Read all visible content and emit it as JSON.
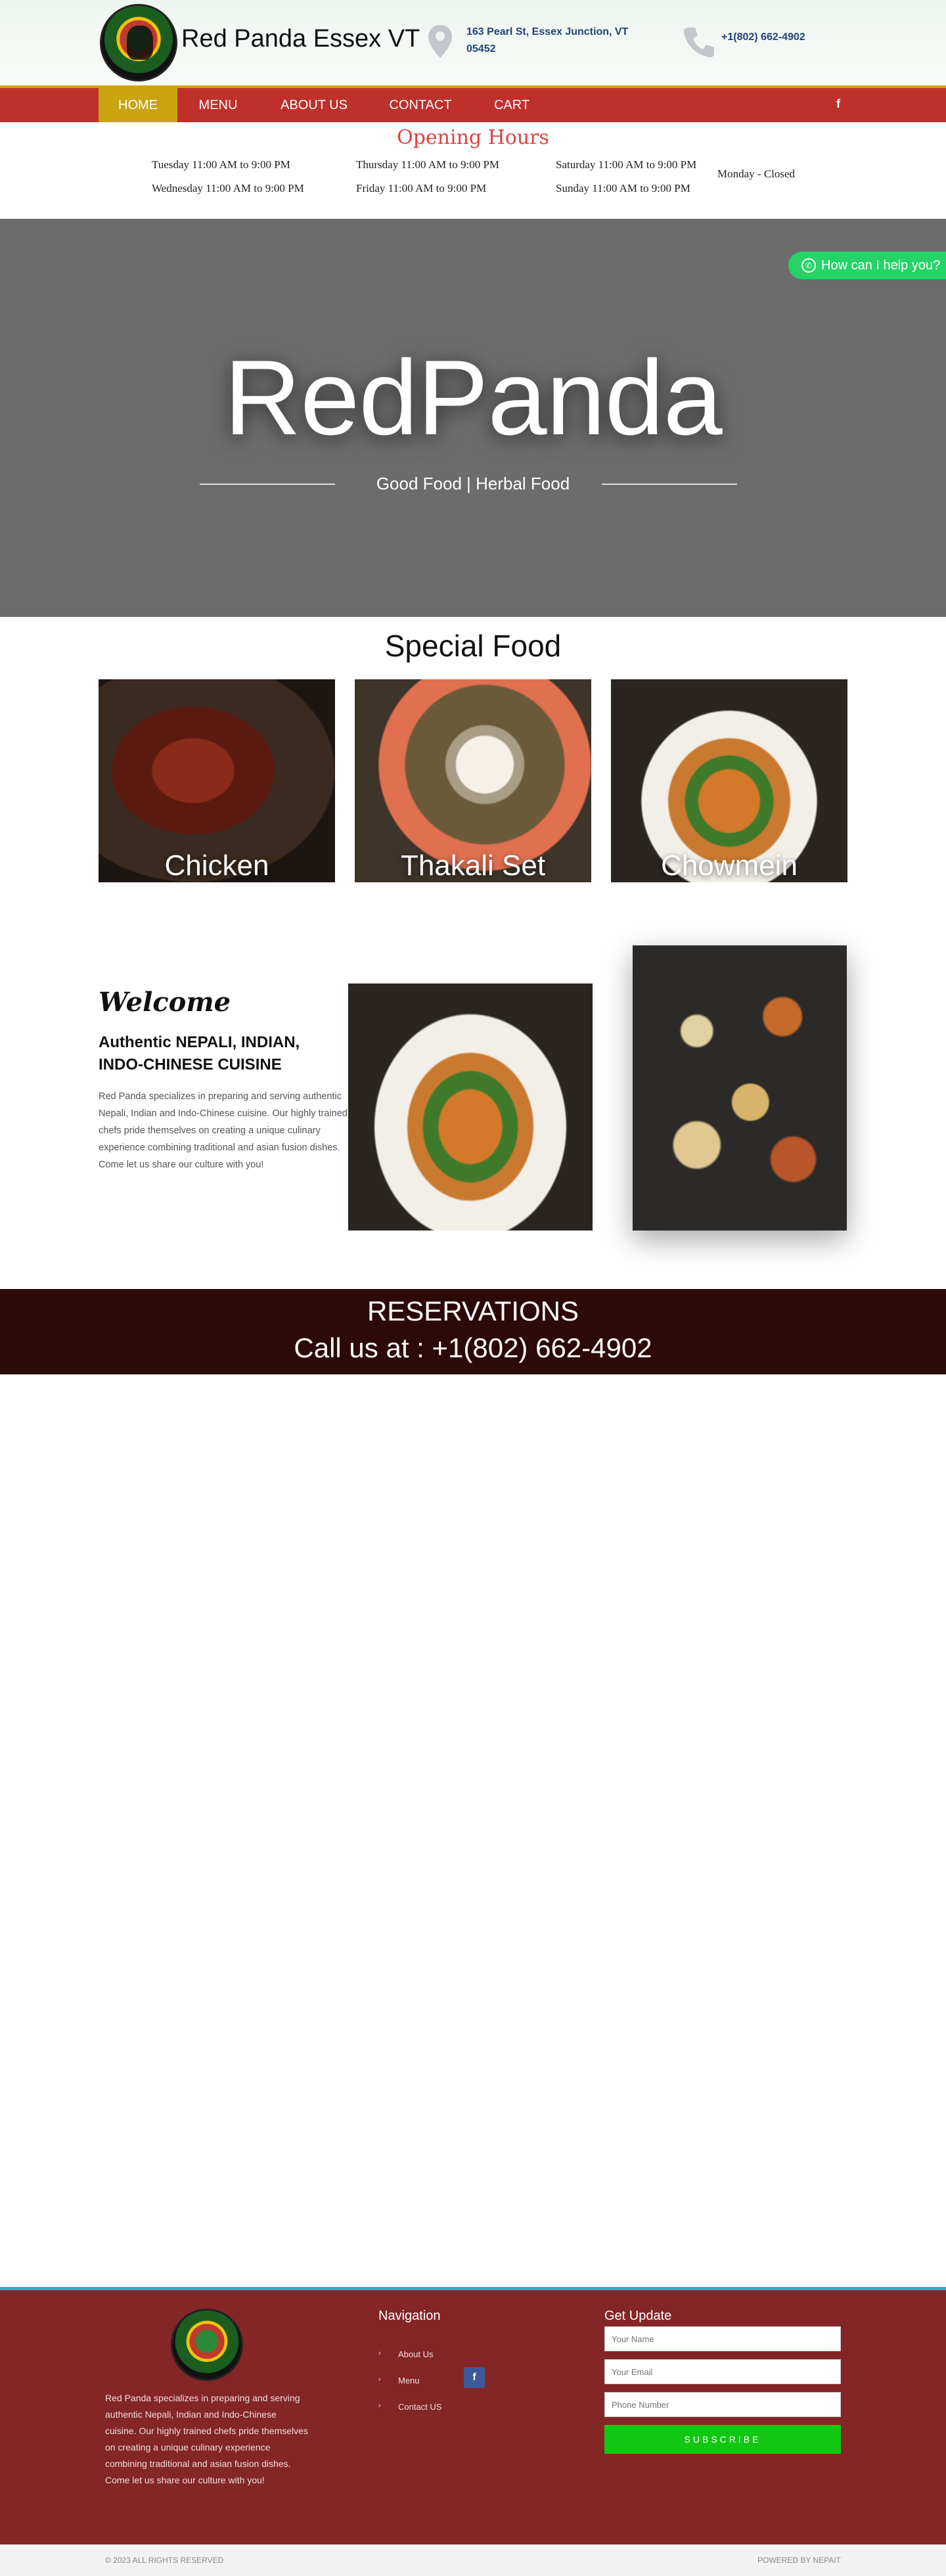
{
  "header": {
    "brand": "Red Panda Essex VT",
    "address": "163 Pearl St, Essex Junction, VT 05452",
    "phone": "+1(802) 662-4902"
  },
  "nav": {
    "items": [
      {
        "label": "HOME",
        "active": true
      },
      {
        "label": "MENU",
        "active": false
      },
      {
        "label": "ABOUT US",
        "active": false
      },
      {
        "label": "CONTACT",
        "active": false
      },
      {
        "label": "CART",
        "active": false
      }
    ],
    "facebook": "f"
  },
  "hours": {
    "title": "Opening Hours",
    "days": [
      "Tuesday 11:00 AM to 9:00 PM",
      "Thursday 11:00 AM to 9:00 PM",
      "Saturday 11:00 AM to 9:00 PM",
      "Wednesday 11:00 AM to 9:00 PM",
      "Friday 11:00 AM to 9:00 PM",
      "Sunday 11:00 AM to 9:00 PM",
      "Monday - Closed"
    ]
  },
  "hero": {
    "title": "RedPanda",
    "subtitle": "Good Food | Herbal Food",
    "whatsapp": "How can I help you?"
  },
  "special": {
    "title": "Special Food",
    "items": [
      "Chicken",
      "Thakali Set",
      "Chowmein"
    ]
  },
  "welcome": {
    "title": "Welcome",
    "subtitle": "Authentic NEPALI, INDIAN, INDO-CHINESE CUISINE",
    "text": "Red Panda specializes in preparing and serving authentic Nepali, Indian and Indo-Chinese cuisine. Our highly trained chefs pride themselves on creating a unique culinary experience combining traditional and asian fusion dishes. Come let us share our culture with you!"
  },
  "reservations": {
    "title": "RESERVATIONS",
    "call": "Call us at : +1(802) 662-4902"
  },
  "footer": {
    "about": "Red Panda specializes in preparing and serving authentic Nepali, Indian and Indo-Chinese cuisine. Our highly trained chefs pride themselves on creating a unique culinary experience combining traditional and asian fusion dishes. Come let us share our culture with you!",
    "nav_title": "Navigation",
    "links": [
      "About Us",
      "Menu",
      "Contact US"
    ],
    "facebook": "f",
    "update_title": "Get Update",
    "name_placeholder": "Your Name",
    "email_placeholder": "Your Email",
    "phone_placeholder": "Phone Number",
    "subscribe": "SUBSCRIBE",
    "copyright": "© 2023 ALL RIGHTS RESERVED",
    "powered": "POWERED BY NEPAIT"
  },
  "colors": {
    "nav_red": "#c0302a",
    "nav_active": "#c9a310",
    "accent_green": "#12c712",
    "footer_red": "#842626"
  }
}
